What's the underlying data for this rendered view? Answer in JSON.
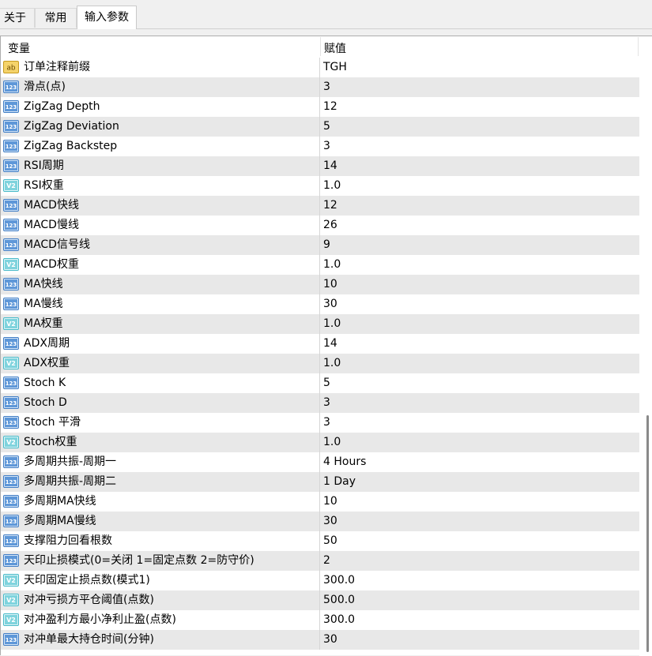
{
  "tabs": [
    {
      "label": "关于"
    },
    {
      "label": "常用"
    },
    {
      "label": "输入参数"
    }
  ],
  "table": {
    "col_variable": "变量",
    "col_value": "赋值",
    "rows": [
      {
        "type": "string",
        "name": "订单注释前缀",
        "value": "TGH"
      },
      {
        "type": "int",
        "name": "滑点(点)",
        "value": "3"
      },
      {
        "type": "int",
        "name": "ZigZag Depth",
        "value": "12"
      },
      {
        "type": "int",
        "name": "ZigZag Deviation",
        "value": "5"
      },
      {
        "type": "int",
        "name": "ZigZag Backstep",
        "value": "3"
      },
      {
        "type": "int",
        "name": "RSI周期",
        "value": "14"
      },
      {
        "type": "double",
        "name": "RSI权重",
        "value": "1.0"
      },
      {
        "type": "int",
        "name": "MACD快线",
        "value": "12"
      },
      {
        "type": "int",
        "name": "MACD慢线",
        "value": "26"
      },
      {
        "type": "int",
        "name": "MACD信号线",
        "value": "9"
      },
      {
        "type": "double",
        "name": "MACD权重",
        "value": "1.0"
      },
      {
        "type": "int",
        "name": "MA快线",
        "value": "10"
      },
      {
        "type": "int",
        "name": "MA慢线",
        "value": "30"
      },
      {
        "type": "double",
        "name": "MA权重",
        "value": "1.0"
      },
      {
        "type": "int",
        "name": "ADX周期",
        "value": "14"
      },
      {
        "type": "double",
        "name": "ADX权重",
        "value": "1.0"
      },
      {
        "type": "int",
        "name": "Stoch K",
        "value": "5"
      },
      {
        "type": "int",
        "name": "Stoch D",
        "value": "3"
      },
      {
        "type": "int",
        "name": "Stoch 平滑",
        "value": "3"
      },
      {
        "type": "double",
        "name": "Stoch权重",
        "value": "1.0"
      },
      {
        "type": "int",
        "name": "多周期共振-周期一",
        "value": "4 Hours"
      },
      {
        "type": "int",
        "name": "多周期共振-周期二",
        "value": "1 Day"
      },
      {
        "type": "int",
        "name": "多周期MA快线",
        "value": "10"
      },
      {
        "type": "int",
        "name": "多周期MA慢线",
        "value": "30"
      },
      {
        "type": "int",
        "name": "支撑阻力回看根数",
        "value": "50"
      },
      {
        "type": "int",
        "name": "天印止损模式(0=关闭 1=固定点数 2=防守价)",
        "value": "2"
      },
      {
        "type": "double",
        "name": "天印固定止损点数(模式1)",
        "value": "300.0"
      },
      {
        "type": "double",
        "name": "对冲亏损方平仓阈值(点数)",
        "value": "500.0"
      },
      {
        "type": "double",
        "name": "对冲盈利方最小净利止盈(点数)",
        "value": "300.0"
      },
      {
        "type": "int",
        "name": "对冲单最大持仓时间(分钟)",
        "value": "30"
      }
    ]
  },
  "icons": {
    "string": {
      "name": "string-type-icon",
      "text": "ab",
      "color": "#e6b93a"
    },
    "int": {
      "name": "integer-type-icon",
      "text": "123",
      "color": "#3f7cc4"
    },
    "double": {
      "name": "double-type-icon",
      "text": "V2",
      "color": "#46b9c8"
    }
  }
}
